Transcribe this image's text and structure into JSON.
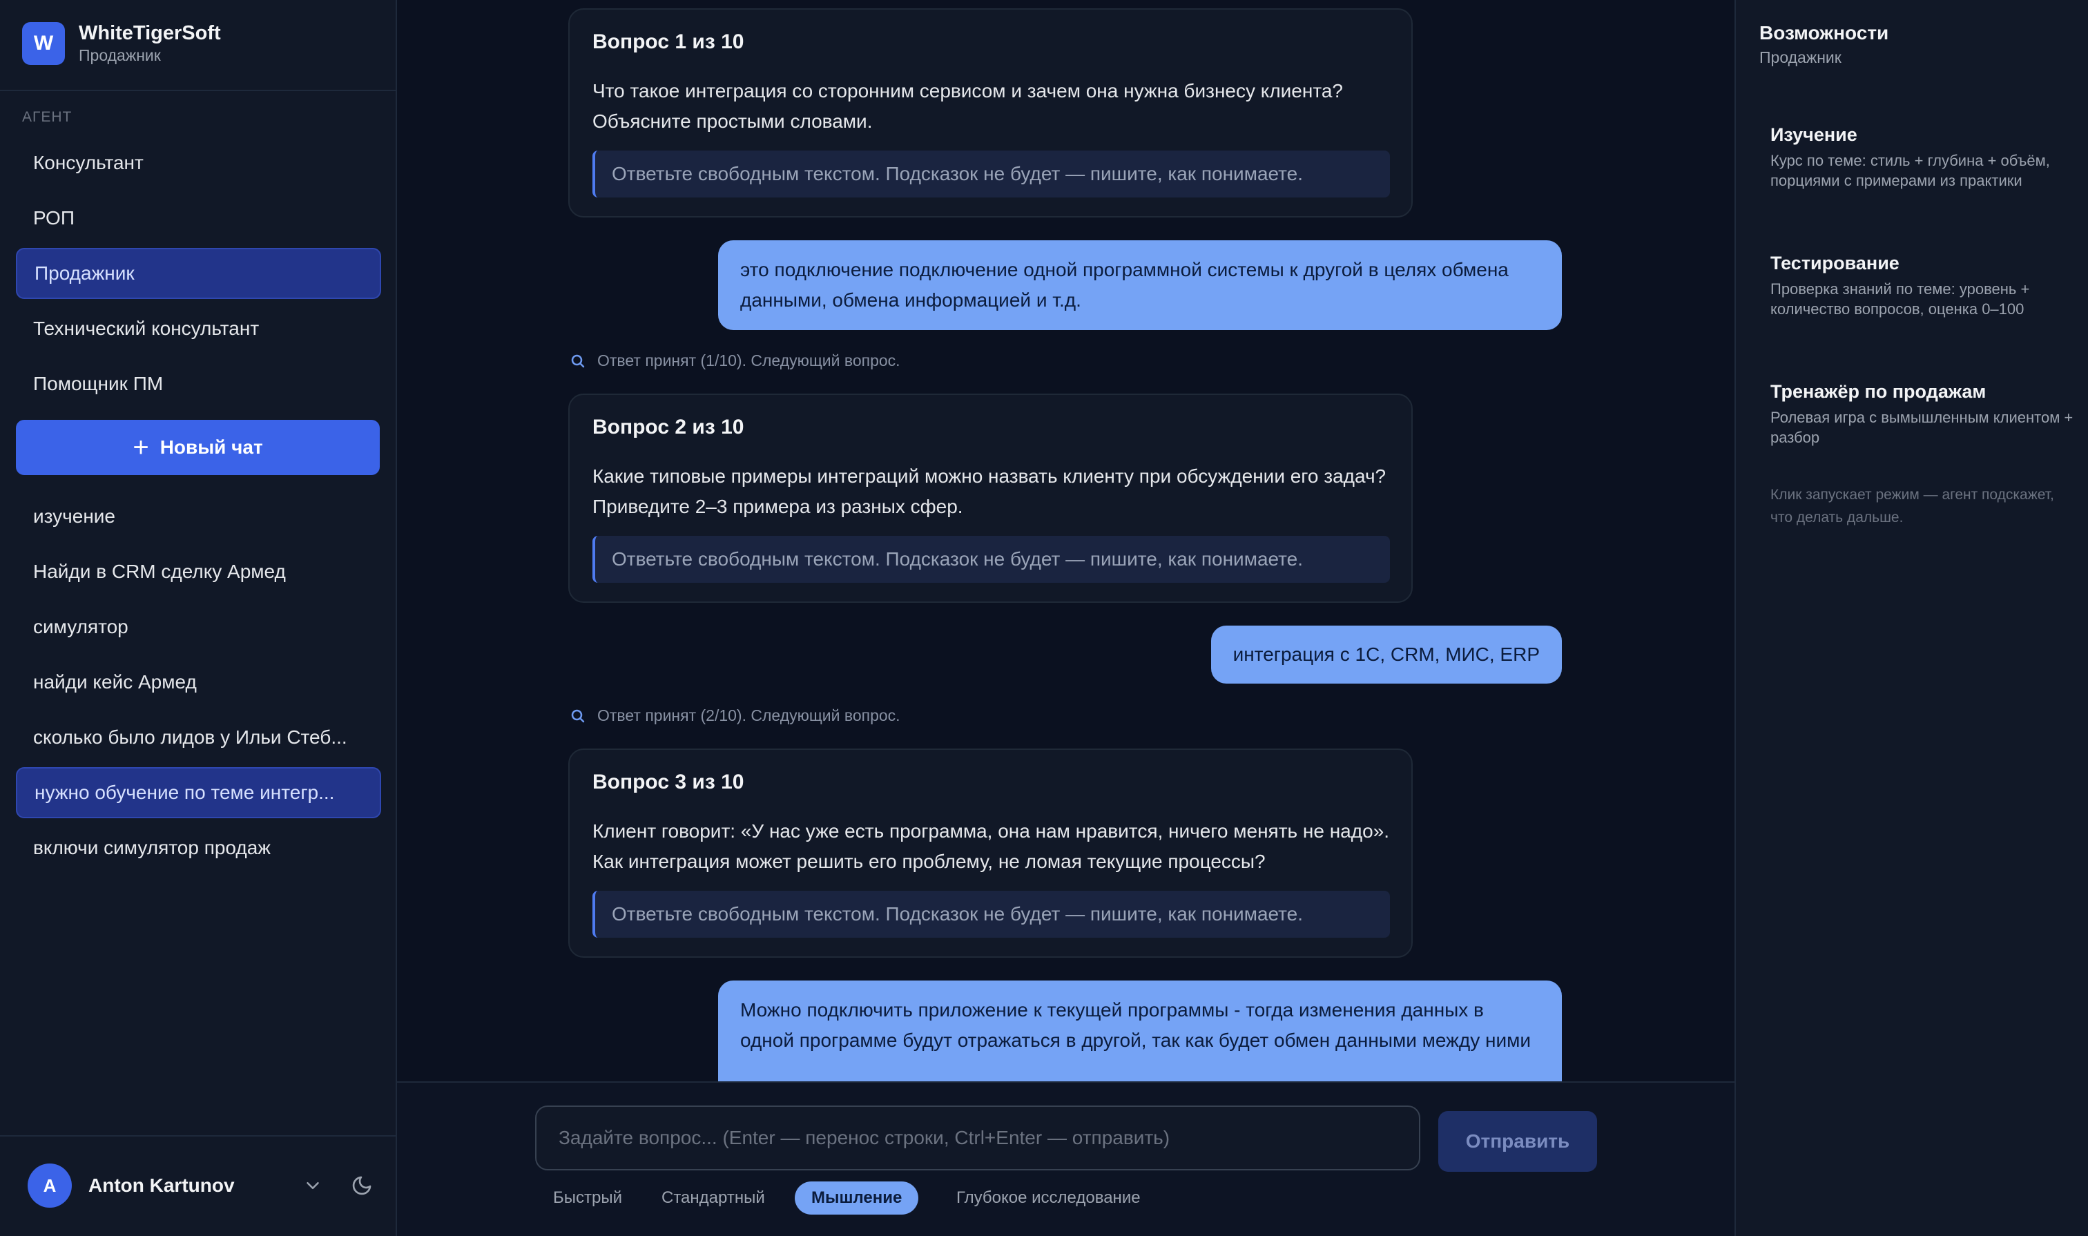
{
  "sidebar": {
    "brand": {
      "logo": "W",
      "name": "WhiteTigerSoft",
      "sub": "Продажник"
    },
    "section_label": "АГЕНТ",
    "agents": [
      {
        "label": "Консультант"
      },
      {
        "label": "РОП"
      },
      {
        "label": "Продажник"
      },
      {
        "label": "Технический консультант"
      },
      {
        "label": "Помощник ПМ"
      }
    ],
    "new_chat_label": "Новый чат",
    "chats": [
      {
        "label": "изучение"
      },
      {
        "label": "Найди в CRM сделку Армед"
      },
      {
        "label": "симулятор"
      },
      {
        "label": "найди кейс Армед"
      },
      {
        "label": "сколько было лидов у Ильи Стеб..."
      },
      {
        "label": "нужно обучение по теме интегр..."
      },
      {
        "label": "включи симулятор продаж"
      }
    ],
    "user": {
      "initial": "A",
      "name": "Anton Kartunov"
    }
  },
  "chat": {
    "questions": [
      {
        "title": "Вопрос 1 из 10",
        "text": "Что такое интеграция со сторонним сервисом и зачем она нужна бизнесу клиента? Объясните простыми словами.",
        "hint": "Ответьте свободным текстом. Подсказок не будет — пишите, как понимаете."
      },
      {
        "title": "Вопрос 2 из 10",
        "text": "Какие типовые примеры интеграций можно назвать клиенту при обсуждении его задач? Приведите 2–3 примера из разных сфер.",
        "hint": "Ответьте свободным текстом. Подсказок не будет — пишите, как понимаете."
      },
      {
        "title": "Вопрос 3 из 10",
        "text": "Клиент говорит: «У нас уже есть программа, она нам нравится, ничего менять не надо». Как интеграция может решить его проблему, не ломая текущие процессы?",
        "hint": "Ответьте свободным текстом. Подсказок не будет — пишите, как понимаете."
      }
    ],
    "answers": [
      {
        "text": "это подключение подключение одной программной системы к другой в целях обмена данными, обмена информацией и т.д."
      },
      {
        "text": "интеграция с 1С, CRM, МИС, ERP"
      },
      {
        "text": "Можно подключить приложение к текущей программы - тогда изменения данных в одной программе будут отражаться в другой, так как будет обмен данными между ними"
      }
    ],
    "statuses": [
      {
        "text": "Ответ принят (1/10). Следующий вопрос."
      },
      {
        "text": "Ответ принят (2/10). Следующий вопрос."
      }
    ]
  },
  "composer": {
    "placeholder": "Задайте вопрос... (Enter — перенос строки, Ctrl+Enter — отправить)",
    "send_label": "Отправить",
    "modes": [
      {
        "label": "Быстрый"
      },
      {
        "label": "Стандартный"
      },
      {
        "label": "Мышление",
        "selected": true
      },
      {
        "label": "Глубокое исследование"
      }
    ]
  },
  "right_panel": {
    "title": "Возможности",
    "sub": "Продажник",
    "features": [
      {
        "title": "Изучение",
        "desc": "Курс по теме: стиль + глубина + объём, порциями с примерами из практики"
      },
      {
        "title": "Тестирование",
        "desc": "Проверка знаний по теме: уровень + количество вопросов, оценка 0–100"
      },
      {
        "title": "Тренажёр по продажам",
        "desc": "Ролевая игра с вымышленным клиентом + разбор"
      }
    ],
    "note": "Клик запускает режим — агент подскажет, что делать дальше."
  },
  "colors": {
    "accent": "#3b63e8",
    "user_bubble": "#75a3f5",
    "background": "#0b1120",
    "panel": "#111827"
  },
  "icons": [
    "plus-icon",
    "chevron-down-icon",
    "moon-icon",
    "search-icon"
  ]
}
